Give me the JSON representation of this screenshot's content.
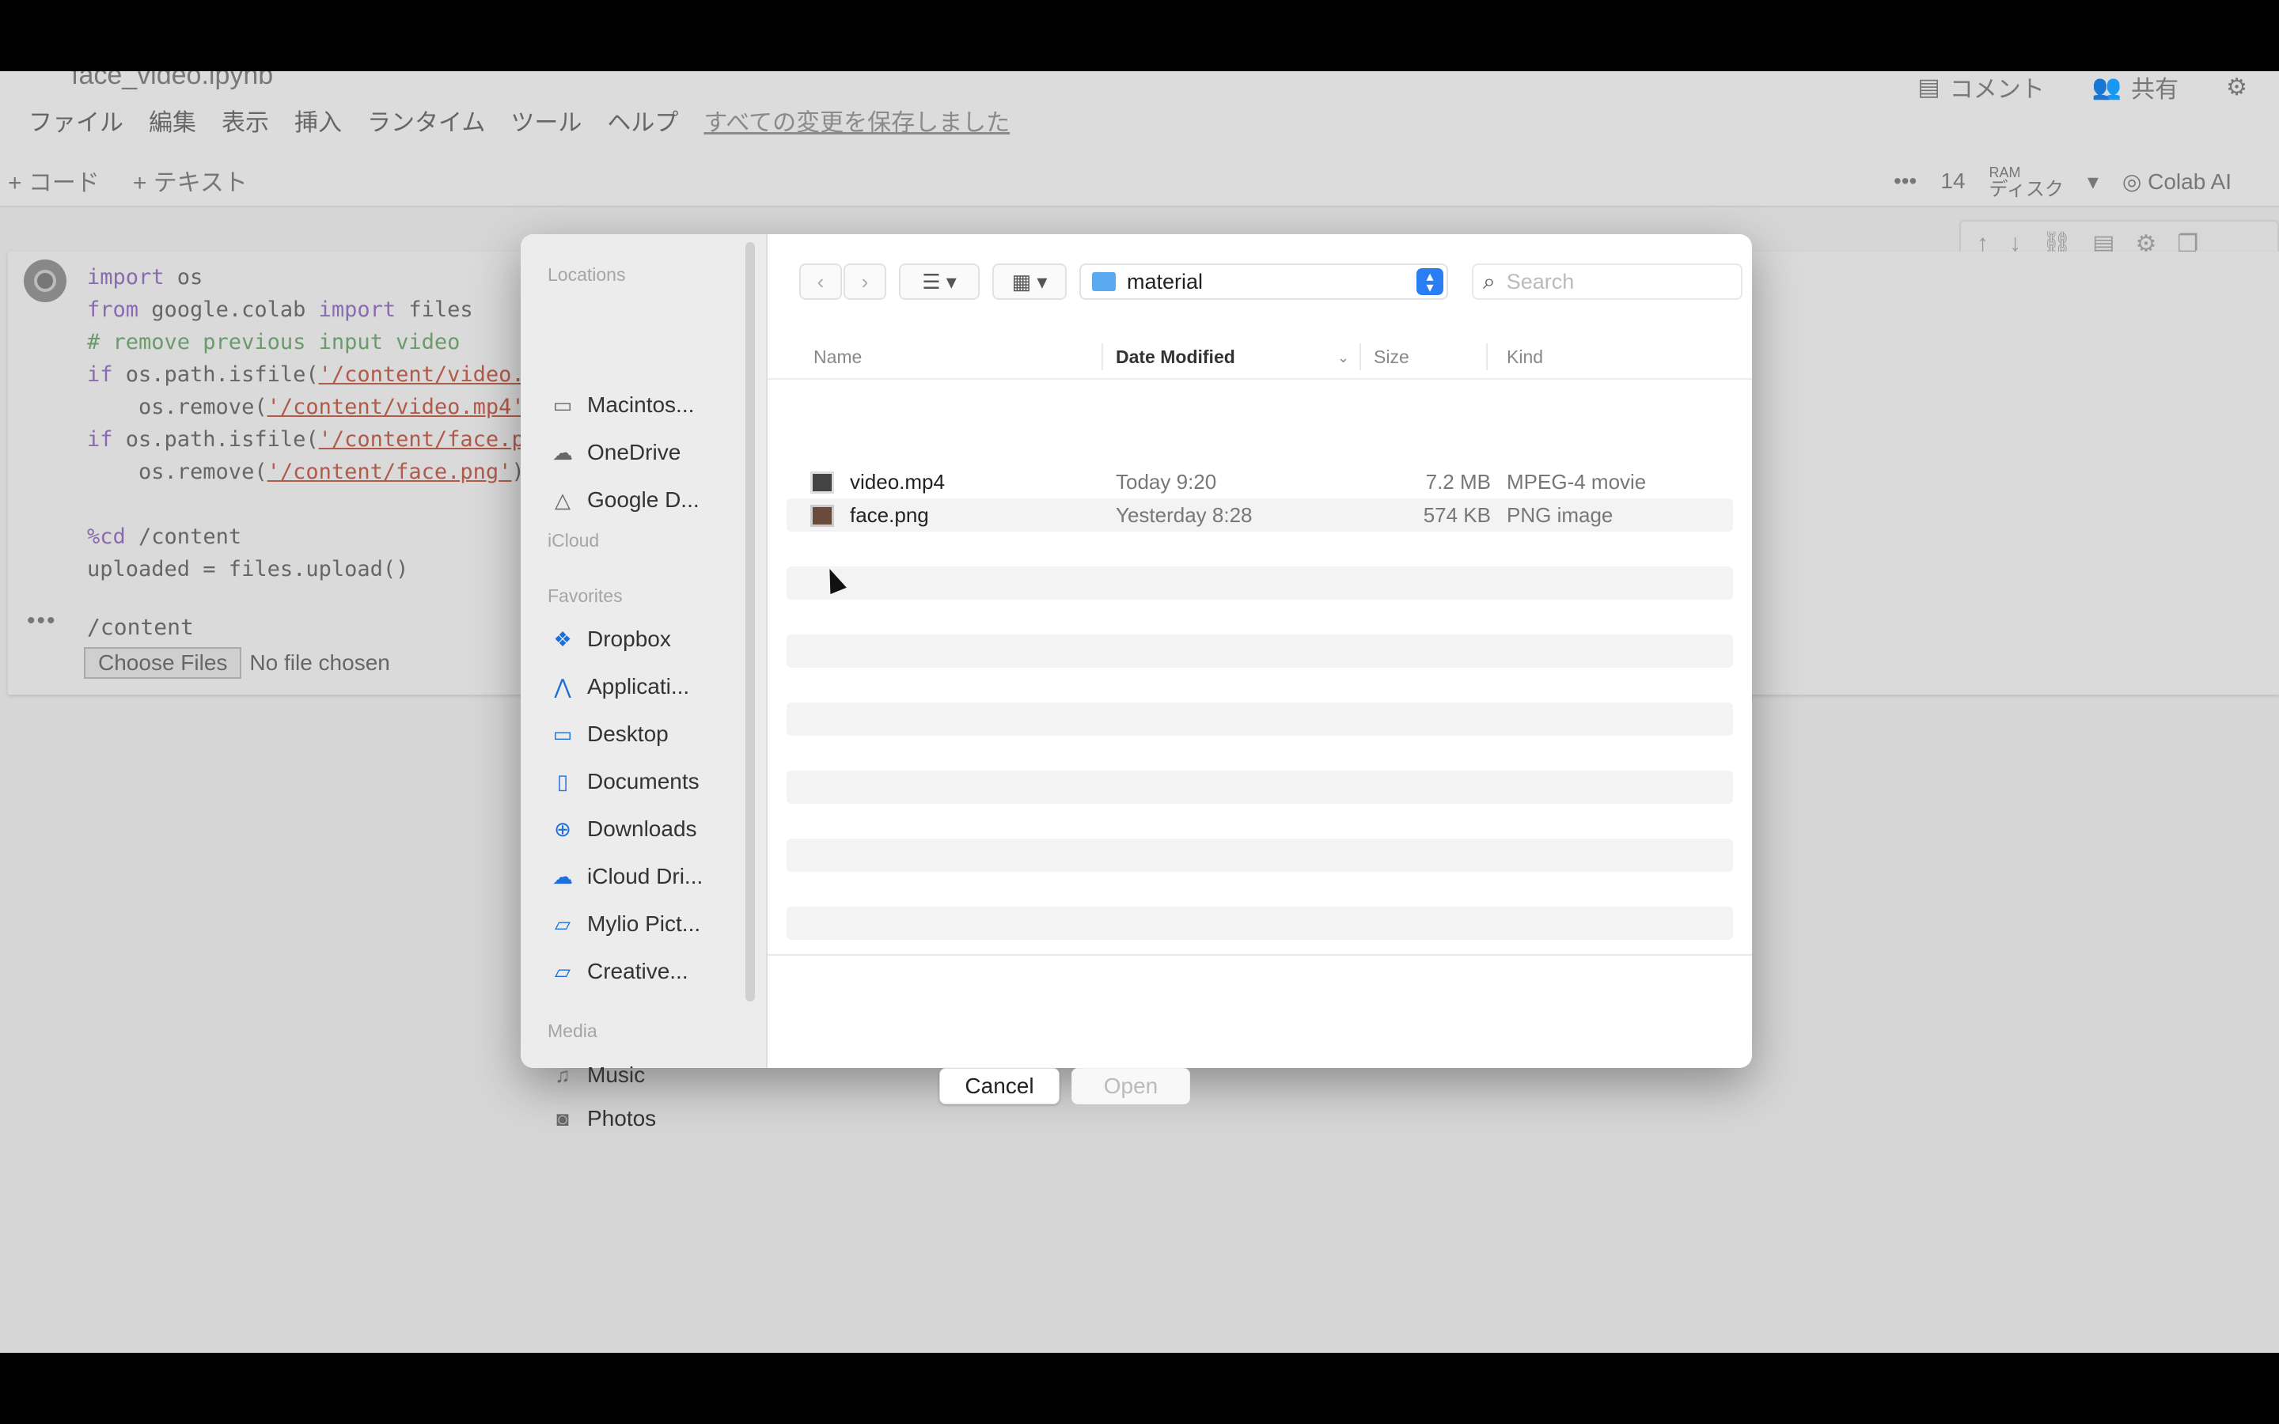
{
  "colab": {
    "notebook_title": "face_video.ipynb",
    "menu": [
      "ファイル",
      "編集",
      "表示",
      "挿入",
      "ランタイム",
      "ツール",
      "ヘルプ",
      "すべての変更を保存しました"
    ],
    "comment_label": "コメント",
    "share_label": "共有",
    "add_code_label": "+ コード",
    "add_text_label": "+ テキスト",
    "counter": "14",
    "ram_label": "RAM",
    "disk_label": "ディスク",
    "colab_ai_label": "Colab AI"
  },
  "cell": {
    "output_path": "/content",
    "choose_files_label": "Choose Files",
    "no_file_label": "No file chosen"
  },
  "dialog": {
    "sidebar": {
      "locations_heading": "Locations",
      "locations": [
        "Macintos...",
        "OneDrive",
        "Google D..."
      ],
      "icloud_heading": "iCloud",
      "favorites_heading": "Favorites",
      "favorites": [
        "Dropbox",
        "Applicati...",
        "Desktop",
        "Documents",
        "Downloads",
        "iCloud Dri...",
        "Mylio Pict...",
        "Creative..."
      ],
      "media_heading": "Media",
      "media": [
        "Music",
        "Photos"
      ]
    },
    "folder_name": "material",
    "search_placeholder": "Search",
    "columns": {
      "name": "Name",
      "date": "Date Modified",
      "size": "Size",
      "kind": "Kind"
    },
    "files": [
      {
        "name": "video.mp4",
        "date": "Today 9:20",
        "size": "7.2 MB",
        "kind": "MPEG-4 movie"
      },
      {
        "name": "face.png",
        "date": "Yesterday 8:28",
        "size": "574 KB",
        "kind": "PNG image"
      }
    ],
    "cancel_label": "Cancel",
    "open_label": "Open"
  }
}
